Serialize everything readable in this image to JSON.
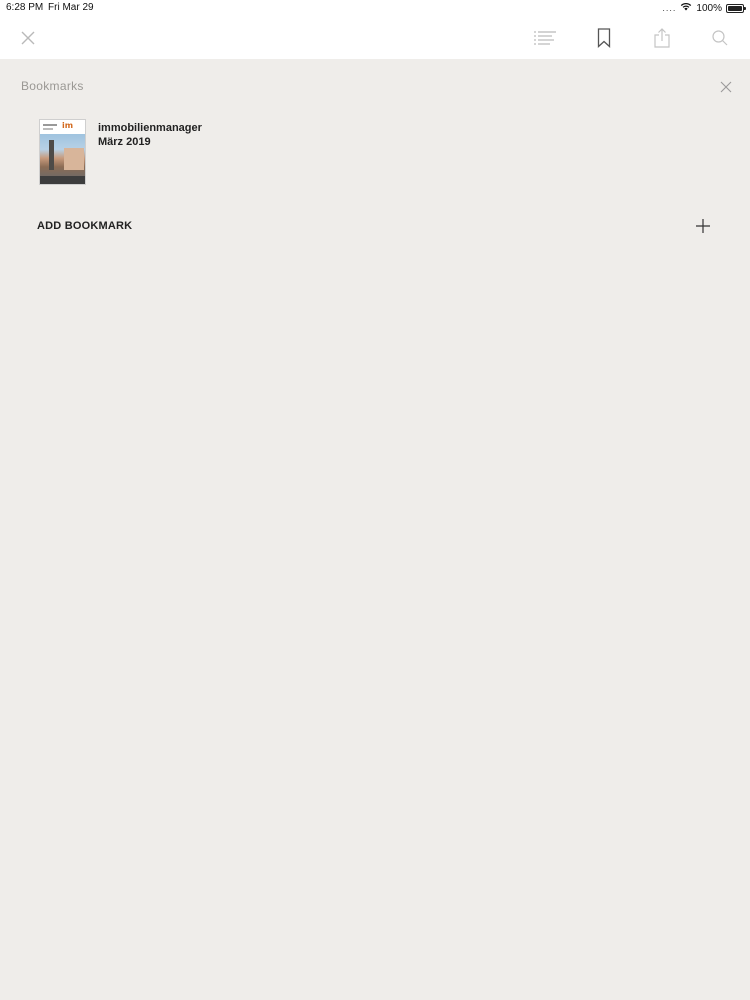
{
  "status_bar": {
    "time": "6:28 PM",
    "date": "Fri Mar 29",
    "signal": "....",
    "battery": "100%"
  },
  "toolbar": {
    "icons": [
      "close-icon",
      "table-of-contents-icon",
      "bookmark-icon",
      "share-icon",
      "search-icon"
    ]
  },
  "panel": {
    "title": "Bookmarks",
    "bookmarks": [
      {
        "publication": "immobilienmanager",
        "issue": "März 2019",
        "cover_logo": "im"
      }
    ],
    "add_label": "ADD BOOKMARK"
  },
  "colors": {
    "panel_background": "#efedea",
    "toolbar_background": "#ffffff",
    "icon_gray": "#b5b5b5",
    "text_dark": "#222222"
  }
}
